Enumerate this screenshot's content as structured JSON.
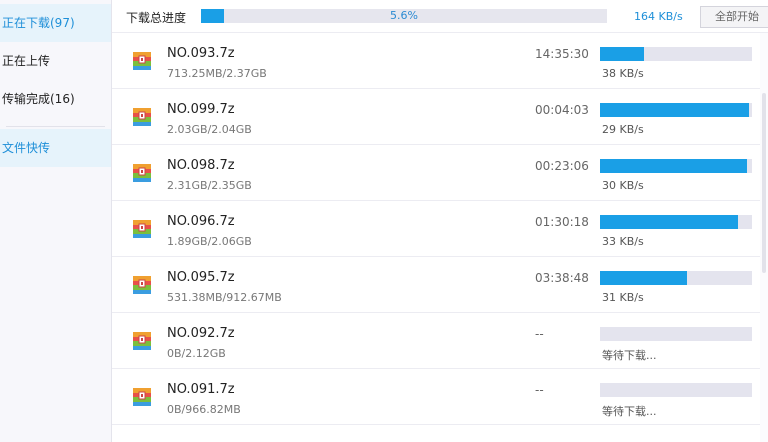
{
  "sidebar": {
    "items": [
      {
        "label": "正在下载(97)",
        "active": true
      },
      {
        "label": "正在上传",
        "active": false
      },
      {
        "label": "传输完成(16)",
        "active": false
      },
      {
        "label": "文件快传",
        "active": true
      }
    ]
  },
  "topbar": {
    "label": "下载总进度",
    "percent_text": "5.6%",
    "percent": 5.6,
    "speed": "164 KB/s",
    "start_all_label": "全部开始"
  },
  "colors": {
    "accent": "#1a9fe6",
    "track": "#e4e4ee",
    "active_bg": "#e6f3fb"
  },
  "files": [
    {
      "name": "NO.093.7z",
      "size": "713.25MB/2.37GB",
      "time": "14:35:30",
      "status": "38 KB/s",
      "progress": 0.29
    },
    {
      "name": "NO.099.7z",
      "size": "2.03GB/2.04GB",
      "time": "00:04:03",
      "status": "29 KB/s",
      "progress": 0.98
    },
    {
      "name": "NO.098.7z",
      "size": "2.31GB/2.35GB",
      "time": "00:23:06",
      "status": "30 KB/s",
      "progress": 0.97
    },
    {
      "name": "NO.096.7z",
      "size": "1.89GB/2.06GB",
      "time": "01:30:18",
      "status": "33 KB/s",
      "progress": 0.91
    },
    {
      "name": "NO.095.7z",
      "size": "531.38MB/912.67MB",
      "time": "03:38:48",
      "status": "31 KB/s",
      "progress": 0.57
    },
    {
      "name": "NO.092.7z",
      "size": "0B/2.12GB",
      "time": "--",
      "status": "等待下载...",
      "progress": 0
    },
    {
      "name": "NO.091.7z",
      "size": "0B/966.82MB",
      "time": "--",
      "status": "等待下载...",
      "progress": 0
    }
  ]
}
